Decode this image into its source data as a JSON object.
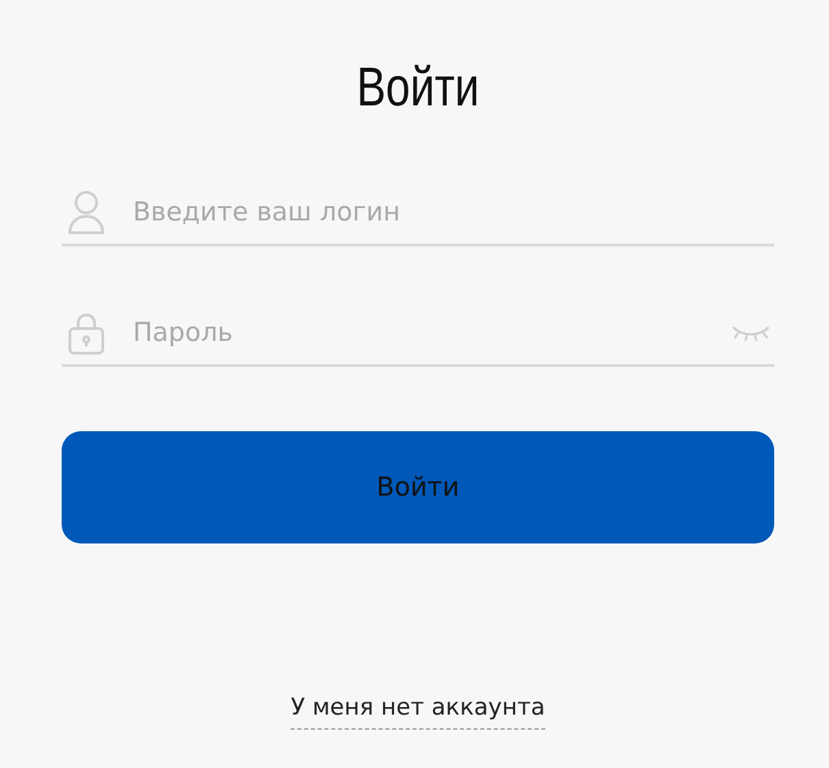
{
  "title": "Войти",
  "fields": [
    {
      "kind": "login",
      "placeholder": "Введите ваш логин"
    },
    {
      "kind": "password",
      "placeholder": "Пароль"
    }
  ],
  "submit": {
    "label": "Войти"
  },
  "link": {
    "label": "У меня нет аккаунта"
  }
}
